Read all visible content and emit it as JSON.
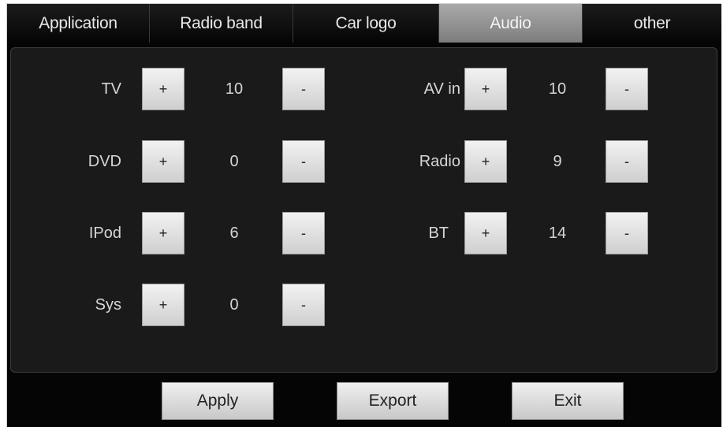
{
  "tabs": [
    {
      "label": "Application",
      "active": false
    },
    {
      "label": "Radio band",
      "active": false
    },
    {
      "label": "Car logo",
      "active": false
    },
    {
      "label": "Audio",
      "active": true
    },
    {
      "label": "other",
      "active": false
    }
  ],
  "audio": {
    "plus_label": "+",
    "minus_label": "-",
    "channels": {
      "tv": {
        "label": "TV",
        "value": "10"
      },
      "dvd": {
        "label": "DVD",
        "value": "0"
      },
      "ipod": {
        "label": "IPod",
        "value": "6"
      },
      "sys": {
        "label": "Sys",
        "value": "0"
      },
      "av_in": {
        "label": "AV in",
        "value": "10"
      },
      "radio": {
        "label": "Radio",
        "value": "9"
      },
      "bt": {
        "label": "BT",
        "value": "14"
      }
    }
  },
  "actions": {
    "apply_label": "Apply",
    "export_label": "Export",
    "exit_label": "Exit"
  },
  "colors": {
    "background": "#050505",
    "active_tab": "#9a9a9a",
    "button": "#e0e0e0",
    "text": "#d6d6d6"
  }
}
